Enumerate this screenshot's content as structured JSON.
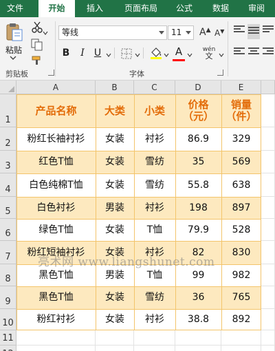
{
  "ribbon": {
    "tabs": [
      {
        "label": "文件",
        "active": false
      },
      {
        "label": "开始",
        "active": true
      },
      {
        "label": "插入",
        "active": false
      },
      {
        "label": "页面布局",
        "active": false
      },
      {
        "label": "公式",
        "active": false
      },
      {
        "label": "数据",
        "active": false
      },
      {
        "label": "审阅",
        "active": false
      }
    ],
    "clipboard": {
      "paste_label": "粘贴",
      "group_label": "剪贴板"
    },
    "font": {
      "name": "等线",
      "size": "11",
      "group_label": "字体",
      "bold": "B",
      "italic": "I",
      "underline": "U",
      "grow": "A",
      "shrink": "A",
      "font_color_glyph": "A",
      "phonetic": "wén"
    },
    "colors": {
      "brand": "#217346",
      "fill": "#ffff00",
      "font": "#ff0000"
    }
  },
  "sheet": {
    "columns": [
      "A",
      "B",
      "C",
      "D",
      "E"
    ],
    "rows": [
      "1",
      "2",
      "3",
      "4",
      "5",
      "6",
      "7",
      "8",
      "9",
      "10",
      "11",
      "12"
    ],
    "header": [
      "产品名称",
      "大类",
      "小类",
      "价格\n（元）",
      "销量\n（件）"
    ],
    "data": [
      [
        "粉红长袖衬衫",
        "女装",
        "衬衫",
        "86.9",
        "329"
      ],
      [
        "红色T恤",
        "女装",
        "雪纺",
        "35",
        "569"
      ],
      [
        "白色纯棉T恤",
        "女装",
        "雪纺",
        "55.8",
        "638"
      ],
      [
        "白色衬衫",
        "男装",
        "衬衫",
        "198",
        "897"
      ],
      [
        "绿色T恤",
        "女装",
        "T恤",
        "79.9",
        "528"
      ],
      [
        "粉红短袖衬衫",
        "女装",
        "衬衫",
        "82",
        "830"
      ],
      [
        "黑色T恤",
        "男装",
        "T恤",
        "99",
        "982"
      ],
      [
        "黑色T恤",
        "女装",
        "雪纺",
        "36",
        "765"
      ],
      [
        "粉红衬衫",
        "女装",
        "衬衫",
        "38.8",
        "892"
      ]
    ],
    "colors": {
      "band": "#fde9bf",
      "header_text": "#e36c09",
      "border": "#f3c46a"
    }
  },
  "watermark": "亮术网 www.liangshunet.com"
}
